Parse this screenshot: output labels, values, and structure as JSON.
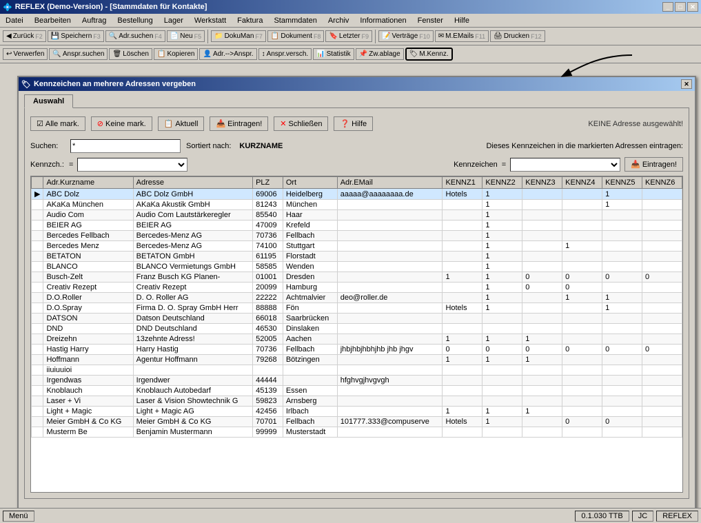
{
  "window": {
    "title": "REFLEX (Demo-Version) - [Stammdaten für Kontakte]",
    "icon": "💠"
  },
  "menubar": {
    "items": [
      "Datei",
      "Bearbeiten",
      "Auftrag",
      "Bestellung",
      "Lager",
      "Werkstatt",
      "Faktura",
      "Stammdaten",
      "Archiv",
      "Informationen",
      "Fenster",
      "Hilfe"
    ]
  },
  "toolbar1": {
    "back_label": "Zurück",
    "back_key": "F2",
    "save_label": "Speichern",
    "save_key": "F3",
    "search_label": "Adr.suchen",
    "search_key": "F4",
    "new_label": "Neu",
    "new_key": "F5",
    "dokuman_label": "DokuMan",
    "dokuman_key": "F7",
    "document_label": "Dokument",
    "document_key": "F8",
    "last_label": "Letzter",
    "last_key": "F9",
    "contracts_label": "Verträge",
    "contracts_key": "F10",
    "memails_label": "M.EMails",
    "memails_key": "F11",
    "print_label": "Drucken",
    "print_key": "F12"
  },
  "toolbar2": {
    "discard_label": "Verwerfen",
    "anspr_label": "Anspr.suchen",
    "delete_label": "Löschen",
    "copy_label": "Kopieren",
    "adr_anspr_label": "Adr.-->Anspr.",
    "anspr_versch_label": "Anspr.versch.",
    "statistik_label": "Statistik",
    "zw_ablage_label": "Zw.ablage",
    "mkennz_label": "M.Kennz."
  },
  "dialog": {
    "title": "Kennzeichen an mehrere Adressen vergeben",
    "tab_label": "Auswahl",
    "buttons": {
      "alle_mark": "Alle mark.",
      "keine_mark": "Keine mark.",
      "aktuell": "Aktuell",
      "eintragen": "Eintragen!",
      "schliessen": "Schließen",
      "hilfe": "Hilfe"
    },
    "status_text": "KEINE Adresse ausgewählt!",
    "search": {
      "label": "Suchen:",
      "value": "*",
      "sort_label": "Sortiert nach:",
      "sort_value": "KURZNAME"
    },
    "kennzeichen": {
      "label": "Kennzch.:",
      "eq": "=",
      "value": "",
      "desc": "Dieses Kennzeichen in die markierten Adressen eintragen:",
      "right_label": "Kennzeichen",
      "right_eq": "=",
      "right_value": "",
      "eintragen_label": "Eintragen!"
    },
    "table": {
      "columns": [
        "",
        "Adr.Kurzname",
        "Adresse",
        "PLZ",
        "Ort",
        "Adr.EMail",
        "KENNZ1",
        "KENNZ2",
        "KENNZ3",
        "KENNZ4",
        "KENNZ5",
        "KENNZ6"
      ],
      "rows": [
        {
          "marker": "▶",
          "kurzname": "ABC Dolz",
          "adresse": "ABC Dolz GmbH",
          "plz": "69006",
          "ort": "Heidelberg",
          "email": "aaaaa@aaaaaaaa.de",
          "k1": "Hotels",
          "k2": "1",
          "k3": "",
          "k4": "",
          "k5": "1",
          "k6": ""
        },
        {
          "marker": "",
          "kurzname": "AKaKa München",
          "adresse": "AKaKa Akustik GmbH",
          "plz": "81243",
          "ort": "München",
          "email": "",
          "k1": "",
          "k2": "1",
          "k3": "",
          "k4": "",
          "k5": "1",
          "k6": ""
        },
        {
          "marker": "",
          "kurzname": "Audio Com",
          "adresse": "Audio Com Lautstärkeregler",
          "plz": "85540",
          "ort": "Haar",
          "email": "",
          "k1": "",
          "k2": "1",
          "k3": "",
          "k4": "",
          "k5": "",
          "k6": ""
        },
        {
          "marker": "",
          "kurzname": "BEIER AG",
          "adresse": "BEIER AG",
          "plz": "47009",
          "ort": "Krefeld",
          "email": "",
          "k1": "",
          "k2": "1",
          "k3": "",
          "k4": "",
          "k5": "",
          "k6": ""
        },
        {
          "marker": "",
          "kurzname": "Bercedes Fellbach",
          "adresse": "Bercedes-Menz AG",
          "plz": "70736",
          "ort": "Fellbach",
          "email": "",
          "k1": "",
          "k2": "1",
          "k3": "",
          "k4": "",
          "k5": "",
          "k6": ""
        },
        {
          "marker": "",
          "kurzname": "Bercedes Menz",
          "adresse": "Bercedes-Menz AG",
          "plz": "74100",
          "ort": "Stuttgart",
          "email": "",
          "k1": "",
          "k2": "1",
          "k3": "",
          "k4": "1",
          "k5": "",
          "k6": ""
        },
        {
          "marker": "",
          "kurzname": "BETATON",
          "adresse": "BETATON GmbH",
          "plz": "61195",
          "ort": "Florstadt",
          "email": "",
          "k1": "",
          "k2": "1",
          "k3": "",
          "k4": "",
          "k5": "",
          "k6": ""
        },
        {
          "marker": "",
          "kurzname": "BLANCO",
          "adresse": "BLANCO Vermietungs GmbH",
          "plz": "58585",
          "ort": "Wenden",
          "email": "",
          "k1": "",
          "k2": "1",
          "k3": "",
          "k4": "",
          "k5": "",
          "k6": ""
        },
        {
          "marker": "",
          "kurzname": "Busch-Zelt",
          "adresse": "Franz Busch KG Planen-",
          "plz": "01001",
          "ort": "Dresden",
          "email": "",
          "k1": "1",
          "k2": "1",
          "k3": "0",
          "k4": "0",
          "k5": "0",
          "k6": "0"
        },
        {
          "marker": "",
          "kurzname": "Creativ Rezept",
          "adresse": "Creativ Rezept",
          "plz": "20099",
          "ort": "Hamburg",
          "email": "",
          "k1": "",
          "k2": "1",
          "k3": "0",
          "k4": "0",
          "k5": "",
          "k6": ""
        },
        {
          "marker": "",
          "kurzname": "D.O.Roller",
          "adresse": "D. O. Roller AG",
          "plz": "22222",
          "ort": "Achtmalvier",
          "email": "deo@roller.de",
          "k1": "",
          "k2": "1",
          "k3": "",
          "k4": "1",
          "k5": "1",
          "k6": ""
        },
        {
          "marker": "",
          "kurzname": "D.O.Spray",
          "adresse": "Firma D. O. Spray GmbH Herr",
          "plz": "88888",
          "ort": "Fön",
          "email": "",
          "k1": "Hotels",
          "k2": "1",
          "k3": "",
          "k4": "",
          "k5": "1",
          "k6": ""
        },
        {
          "marker": "",
          "kurzname": "DATSON",
          "adresse": "Datson Deutschland",
          "plz": "66018",
          "ort": "Saarbrücken",
          "email": "",
          "k1": "",
          "k2": "",
          "k3": "",
          "k4": "",
          "k5": "",
          "k6": ""
        },
        {
          "marker": "",
          "kurzname": "DND",
          "adresse": "DND Deutschland",
          "plz": "46530",
          "ort": "Dinslaken",
          "email": "",
          "k1": "",
          "k2": "",
          "k3": "",
          "k4": "",
          "k5": "",
          "k6": ""
        },
        {
          "marker": "",
          "kurzname": "Dreizehn",
          "adresse": "13zehnte Adress!",
          "plz": "52005",
          "ort": "Aachen",
          "email": "",
          "k1": "1",
          "k2": "1",
          "k3": "1",
          "k4": "",
          "k5": "",
          "k6": ""
        },
        {
          "marker": "",
          "kurzname": "Hastig Harry",
          "adresse": "Harry Hastig",
          "plz": "70736",
          "ort": "Fellbach",
          "email": "jhbjhbjhbhjhb jhb jhgv",
          "k1": "0",
          "k2": "0",
          "k3": "0",
          "k4": "0",
          "k5": "0",
          "k6": "0"
        },
        {
          "marker": "",
          "kurzname": "Hoffmann",
          "adresse": "Agentur Hoffmann",
          "plz": "79268",
          "ort": "Bötzingen",
          "email": "",
          "k1": "1",
          "k2": "1",
          "k3": "1",
          "k4": "",
          "k5": "",
          "k6": ""
        },
        {
          "marker": "",
          "kurzname": "iiuiuuioi",
          "adresse": "",
          "plz": "",
          "ort": "",
          "email": "",
          "k1": "",
          "k2": "",
          "k3": "",
          "k4": "",
          "k5": "",
          "k6": ""
        },
        {
          "marker": "",
          "kurzname": "Irgendwas",
          "adresse": "Irgendwer",
          "plz": "44444",
          "ort": "",
          "email": "hfghvgjhvgvgh",
          "k1": "",
          "k2": "",
          "k3": "",
          "k4": "",
          "k5": "",
          "k6": ""
        },
        {
          "marker": "",
          "kurzname": "Knoblauch",
          "adresse": "Knoblauch Autobedarf",
          "plz": "45139",
          "ort": "Essen",
          "email": "",
          "k1": "",
          "k2": "",
          "k3": "",
          "k4": "",
          "k5": "",
          "k6": ""
        },
        {
          "marker": "",
          "kurzname": "Laser + Vi",
          "adresse": "Laser & Vision Showtechnik G",
          "plz": "59823",
          "ort": "Arnsberg",
          "email": "",
          "k1": "",
          "k2": "",
          "k3": "",
          "k4": "",
          "k5": "",
          "k6": ""
        },
        {
          "marker": "",
          "kurzname": "Light + Magic",
          "adresse": "Light + Magic AG",
          "plz": "42456",
          "ort": "Irlbach",
          "email": "",
          "k1": "1",
          "k2": "1",
          "k3": "1",
          "k4": "",
          "k5": "",
          "k6": ""
        },
        {
          "marker": "",
          "kurzname": "Meier GmbH & Co KG",
          "adresse": "Meier GmbH & Co KG",
          "plz": "70701",
          "ort": "Fellbach",
          "email": "101777.333@compuserve",
          "k1": "Hotels",
          "k2": "1",
          "k3": "",
          "k4": "0",
          "k5": "0",
          "k6": ""
        },
        {
          "marker": "",
          "kurzname": "Musterm Be",
          "adresse": "Benjamin Mustermann",
          "plz": "99999",
          "ort": "Musterstadt",
          "email": "",
          "k1": "",
          "k2": "",
          "k3": "",
          "k4": "",
          "k5": "",
          "k6": ""
        }
      ]
    }
  },
  "statusbar": {
    "menu": "Menü",
    "version": "0.1.030 TTB",
    "code": "JC",
    "app": "REFLEX"
  }
}
